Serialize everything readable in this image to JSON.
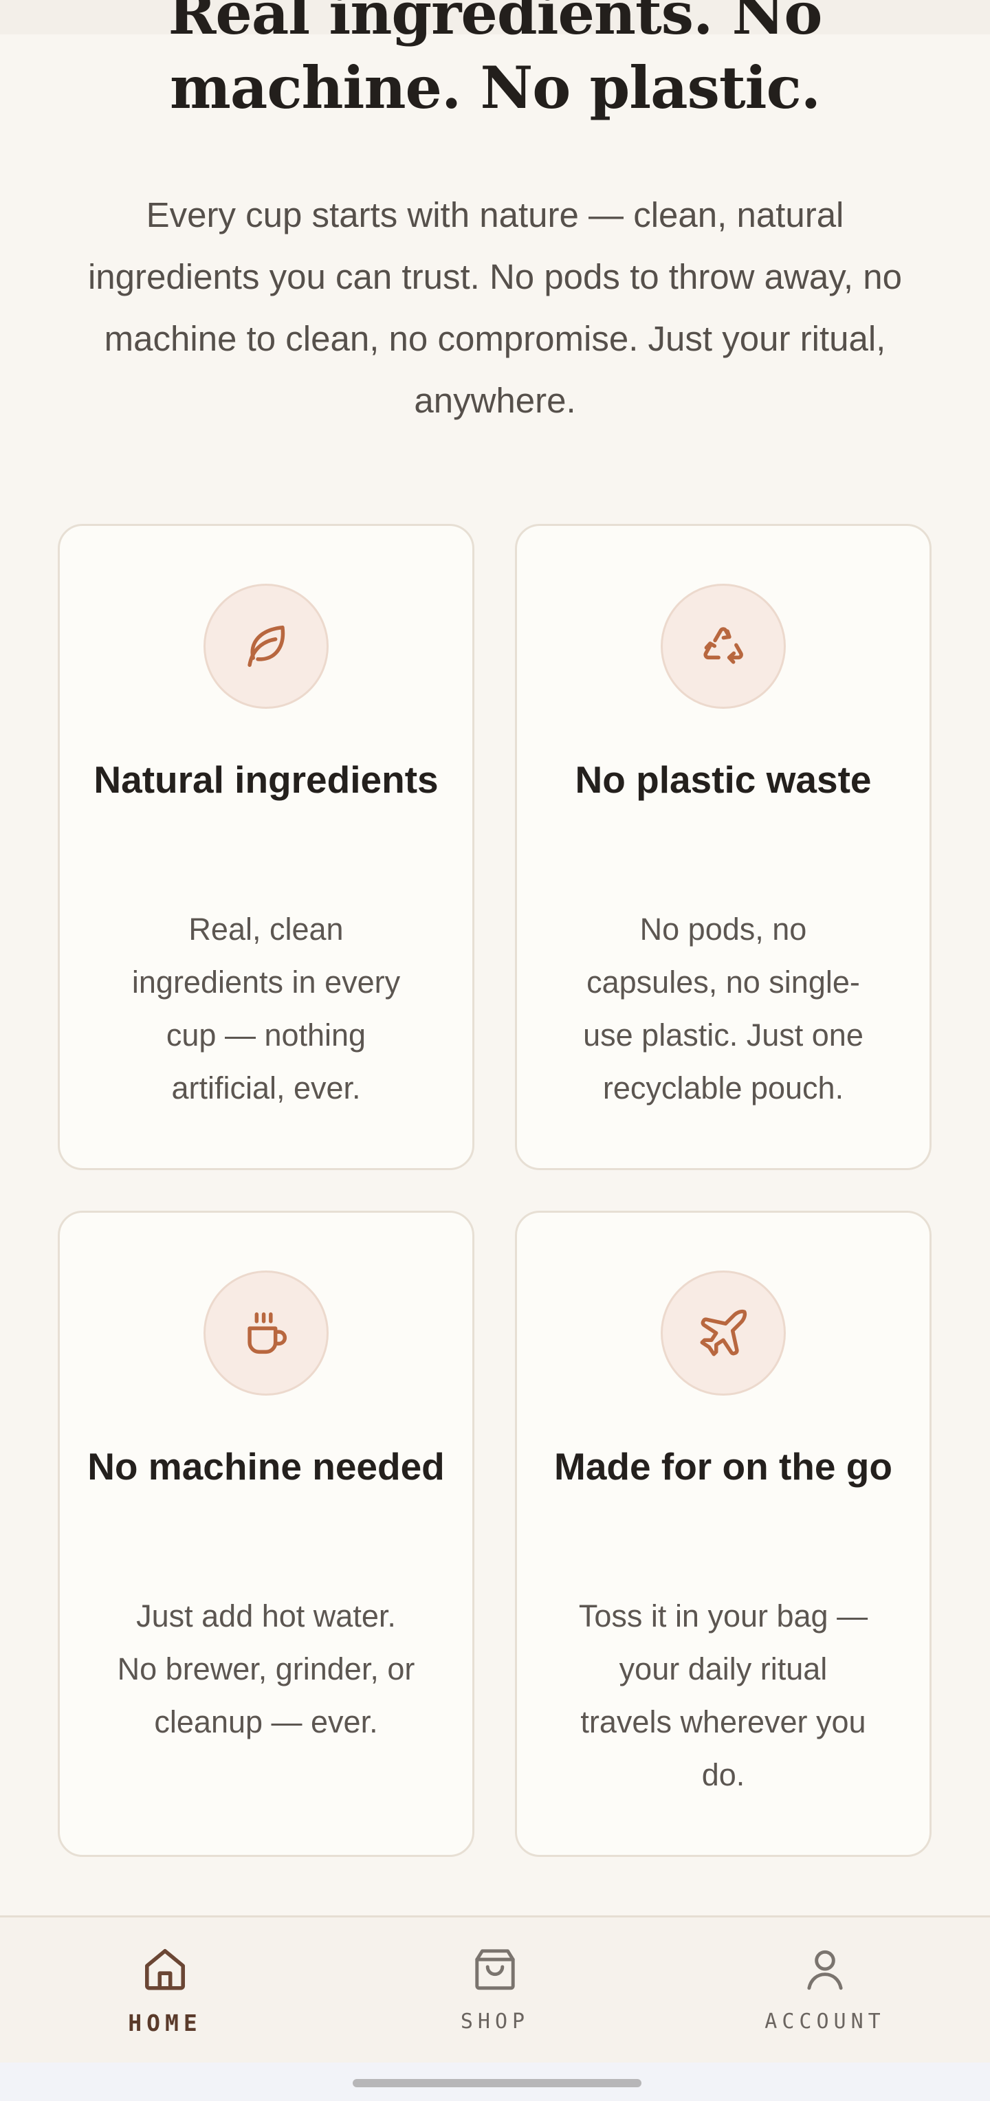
{
  "hero": {
    "headline": "Real ingredients. No machine. No plastic.",
    "intro": "Every cup starts with nature — clean, natural ingredients you can trust. No pods to throw away, no machine to clean, no compromise. Just your ritual, anywhere."
  },
  "features": [
    {
      "icon": "leaf-icon",
      "title": "Natural ingredients",
      "body": "Real, clean ingredients in every cup — nothing artificial, ever."
    },
    {
      "icon": "recycle-icon",
      "title": "No plastic waste",
      "body": "No pods, no capsules, no single-use plastic. Just one recyclable pouch."
    },
    {
      "icon": "coffee-cup-icon",
      "title": "No machine needed",
      "body": "Just add hot water. No brewer, grinder, or cleanup — ever."
    },
    {
      "icon": "airplane-icon",
      "title": "Made for on the go",
      "body": "Toss it in your bag — your daily ritual travels wherever you do."
    }
  ],
  "nav": {
    "items": [
      {
        "label": "HOME",
        "icon": "home-icon",
        "active": true
      },
      {
        "label": "SHOP",
        "icon": "shopping-bag-icon",
        "active": false
      },
      {
        "label": "ACCOUNT",
        "icon": "user-icon",
        "active": false
      }
    ]
  },
  "colors": {
    "background": "#f9f6f1",
    "accent": "#b8673f",
    "card_border": "#e7dfd4",
    "icon_bg": "#f8ebe4"
  }
}
